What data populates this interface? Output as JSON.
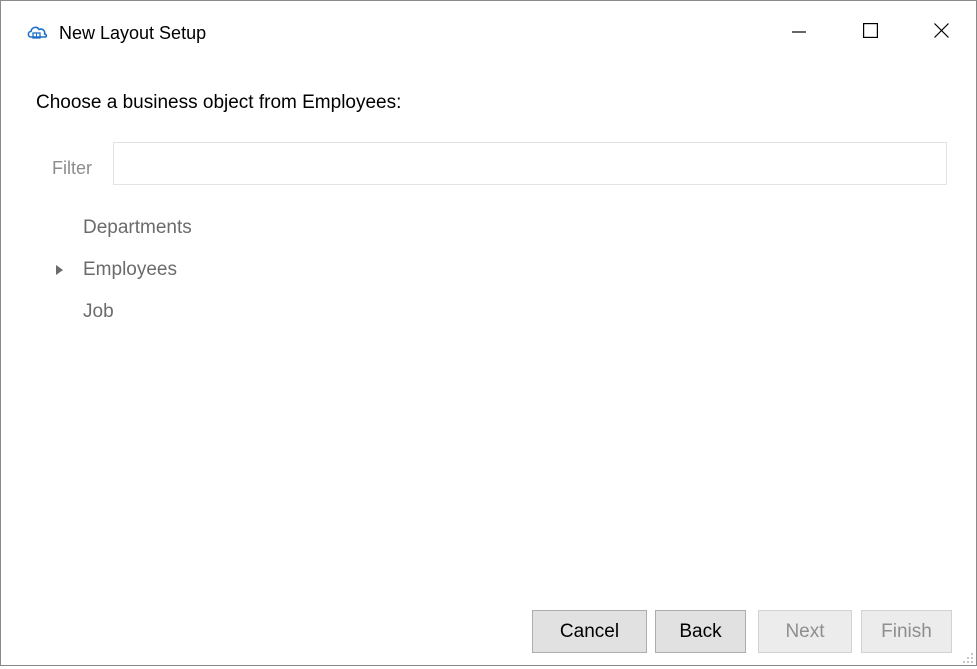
{
  "window": {
    "title": "New Layout Setup",
    "app_icon": "cloud-icon",
    "controls": [
      "minimize-icon",
      "maximize-icon",
      "close-icon"
    ]
  },
  "prompt": "Choose a business object from Employees:",
  "filter": {
    "label": "Filter",
    "value": "",
    "placeholder": ""
  },
  "tree": {
    "items": [
      {
        "label": "Departments",
        "expandable": false
      },
      {
        "label": "Employees",
        "expandable": true
      },
      {
        "label": "Job",
        "expandable": false
      }
    ]
  },
  "buttons": {
    "cancel": "Cancel",
    "back": "Back",
    "next": "Next",
    "finish": "Finish"
  },
  "colors": {
    "tree_text": "#6b6b6b",
    "disabled_text": "#8e8e8e",
    "button_bg": "#e1e1e1",
    "icon_blue": "#1e6fc7"
  }
}
